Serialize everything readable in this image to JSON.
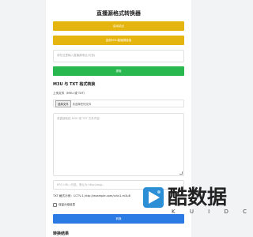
{
  "header": {
    "title": "直播源格式转换器"
  },
  "buttons": {
    "primary": "启动站点",
    "secondary": "复制M3U直播源链接",
    "green": "提取",
    "blue": "转换"
  },
  "url_input": {
    "placeholder": "请在这里输入直播源地址(可选)"
  },
  "m3u_section": {
    "title": "M3U 与 TXT 格式转换",
    "upload_label": "上传文件（M3U 或 TXT）",
    "file_button": "选择文件",
    "file_status": "未选择任何文件",
    "textarea_placeholder": "或直接粘贴 M3U 或 TXT 文件内容",
    "epg_placeholder": "EPG URL (可选，默认为 http://epg...",
    "txt_hint": "TXT 格式示例：CCTV-1,http://example.com/cctv1.m3u8",
    "checkbox_label": "保留分组信息"
  },
  "result": {
    "title": "转换结果"
  },
  "watermark": {
    "text": "酷数据",
    "sub": "K U I D C"
  }
}
